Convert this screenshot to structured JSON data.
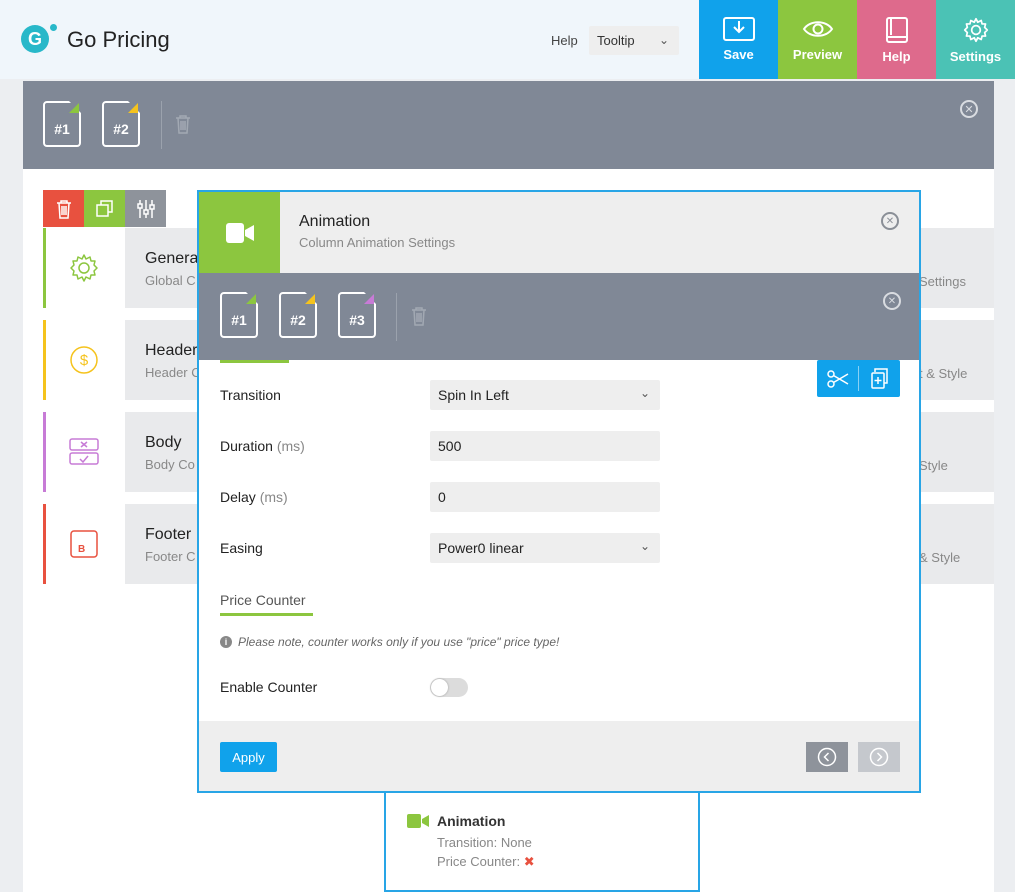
{
  "header": {
    "logo_letter": "G",
    "app_title": "Go Pricing",
    "help_label": "Help",
    "help_mode": "Tooltip",
    "buttons": {
      "save": "Save",
      "preview": "Preview",
      "help": "Help",
      "settings": "Settings"
    }
  },
  "background": {
    "files": [
      "#1",
      "#2"
    ],
    "sections": [
      {
        "title": "Genera",
        "sub": "Global C",
        "right": "Settings",
        "accent": "#8cc63f"
      },
      {
        "title": "Header",
        "sub": "Header C",
        "right": "t & Style",
        "accent": "#f5c31d"
      },
      {
        "title": "Body",
        "sub": "Body Co",
        "right": "Style",
        "accent": "#c77bd6"
      },
      {
        "title": "Footer",
        "sub": "Footer C",
        "right": "& Style",
        "accent": "#e8513f"
      }
    ]
  },
  "modal": {
    "title": "Animation",
    "subtitle": "Column Animation Settings",
    "files": [
      "#1",
      "#2",
      "#3"
    ],
    "fields": {
      "transition_label": "Transition",
      "transition_value": "Spin In Left",
      "duration_label": "Duration",
      "duration_unit": "(ms)",
      "duration_value": "500",
      "delay_label": "Delay",
      "delay_unit": "(ms)",
      "delay_value": "0",
      "easing_label": "Easing",
      "easing_value": "Power0 linear"
    },
    "price_counter": {
      "title": "Price Counter",
      "note": "Please note, counter works only if you use \"price\" price type!",
      "enable_label": "Enable Counter",
      "enabled": false
    },
    "apply_label": "Apply"
  },
  "card": {
    "title": "Animation",
    "transition_line": "Transition: None",
    "price_counter_line": "Price Counter:",
    "price_counter_mark": "✖"
  },
  "colors": {
    "blue": "#10a2eb",
    "green": "#8cc63f",
    "pink": "#de6a8c",
    "teal": "#4bc2b5",
    "gray_bar": "#808896",
    "red": "#e8513f"
  }
}
